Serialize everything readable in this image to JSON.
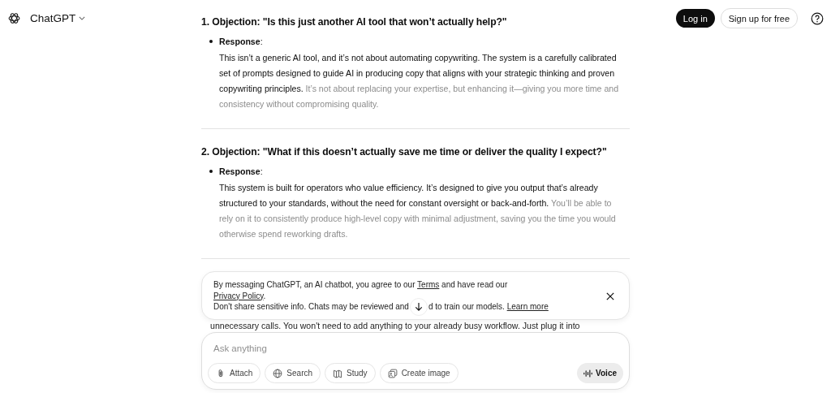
{
  "header": {
    "app_name": "ChatGPT",
    "login": "Log in",
    "signup": "Sign up for free"
  },
  "sections": [
    {
      "heading": "1. Objection: \"Is this just another AI tool that won’t actually help?\"",
      "bullet_label": "Response",
      "bullet_suffix": ":",
      "text": "This isn’t a generic AI tool, and it’s not about automating copywriting. The system is a carefully calibrated set of prompts designed to guide AI in producing copy that aligns with your strategic thinking and proven copywriting principles.",
      "faded_text": "It’s not about replacing your expertise, but enhancing it—giving you more time and consistency without compromising quality."
    },
    {
      "heading": "2. Objection: \"What if this doesn’t actually save me time or deliver the quality I expect?\"",
      "bullet_label": "Response",
      "bullet_suffix": ":",
      "text": "This system is built for operators who value efficiency. It’s designed to give you output that’s already structured to your standards, without the need for constant oversight or back-and-forth.",
      "faded_text": "You’ll be able to rely on it to consistently produce high-level copy with minimal adjustment, saving you the time you would otherwise spend reworking drafts."
    }
  ],
  "peek_line": "unnecessary calls. You won't need to add anything to your already busy workflow. Just plug it into",
  "notice": {
    "line1_before": "By messaging ChatGPT, an AI chatbot, you agree to our",
    "terms": "Terms",
    "line1_after": "and have read our",
    "privacy": "Privacy Policy",
    "privacy_suffix": ".",
    "line2_before": "Don't share sensitive info. Chats may be reviewed and",
    "line2_after": "d to train our models.",
    "learn_more": "Learn more"
  },
  "composer": {
    "placeholder": "Ask anything",
    "tools": [
      {
        "kind": "attach",
        "label": "Attach"
      },
      {
        "kind": "search",
        "label": "Search"
      },
      {
        "kind": "study",
        "label": "Study"
      },
      {
        "kind": "image",
        "label": "Create image"
      }
    ],
    "voice": "Voice"
  }
}
